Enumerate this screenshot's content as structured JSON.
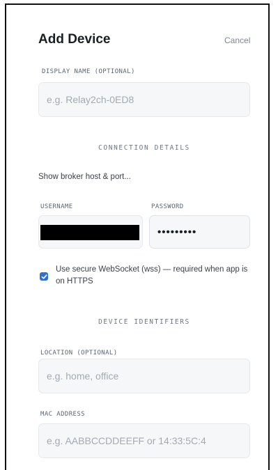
{
  "dialog": {
    "title": "Add Device",
    "cancel_label": "Cancel"
  },
  "display_name": {
    "label": "DISPLAY NAME (OPTIONAL)",
    "placeholder": "e.g. Relay2ch-0ED8",
    "value": ""
  },
  "connection": {
    "section_title": "CONNECTION DETAILS",
    "show_broker_link": "Show broker host & port...",
    "username_label": "USERNAME",
    "password_label": "PASSWORD",
    "password_value": "•••••••••",
    "wss_checkbox": {
      "checked": true,
      "label": "Use secure WebSocket (wss) — required when app is on HTTPS"
    }
  },
  "identifiers": {
    "section_title": "DEVICE IDENTIFIERS",
    "location_label": "LOCATION (OPTIONAL)",
    "location_placeholder": "e.g. home, office",
    "mac_label": "MAC ADDRESS",
    "mac_placeholder": "e.g. AABBCCDDEEFF or 14:33:5C:4"
  },
  "colors": {
    "accent": "#2f6fd6",
    "field_bg": "#f6f7f9",
    "label": "#5c6570"
  }
}
